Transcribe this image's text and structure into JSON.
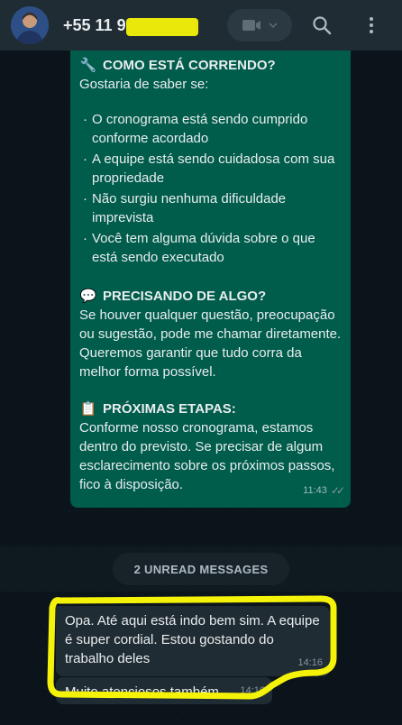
{
  "header": {
    "contact_name": "+55 11 9",
    "video_icon": "video-camera-icon",
    "search_icon": "search-icon",
    "menu_icon": "kebab-menu-icon"
  },
  "outgoing": {
    "section1_title": "COMO ESTÁ CORRENDO?",
    "section1_emoji": "🔧",
    "section1_intro": "Gostaria de saber se:",
    "bullets": [
      "O cronograma está sendo cumprido conforme acordado",
      "A equipe está sendo cuidadosa com sua propriedade",
      "Não surgiu nenhuma dificuldade imprevista",
      "Você tem alguma dúvida sobre o que está sendo executado"
    ],
    "section2_emoji": "💬",
    "section2_title": "PRECISANDO DE ALGO?",
    "section2_text": "Se houver qualquer questão, preocupação ou sugestão, pode me chamar diretamente. Queremos garantir que tudo corra da melhor forma possível.",
    "section3_emoji": "📋",
    "section3_title": "PRÓXIMAS ETAPAS:",
    "section3_text": "Conforme nosso cronograma, estamos dentro do previsto. Se precisar de algum esclarecimento sobre os próximos passos, fico à disposição.",
    "time": "11:43"
  },
  "unread_label": "2 UNREAD MESSAGES",
  "incoming": [
    {
      "text": "Opa. Até aqui está indo bem sim. A equipe é super cordial. Estou gostando do trabalho deles",
      "time": "14:16"
    },
    {
      "text": "Muito atenciosos também",
      "time": "14:16"
    }
  ],
  "colors": {
    "background": "#0b141a",
    "header": "#202c33",
    "outgoing_bubble": "#005c4b",
    "incoming_bubble": "#202c33",
    "highlight": "#f5f20a"
  }
}
